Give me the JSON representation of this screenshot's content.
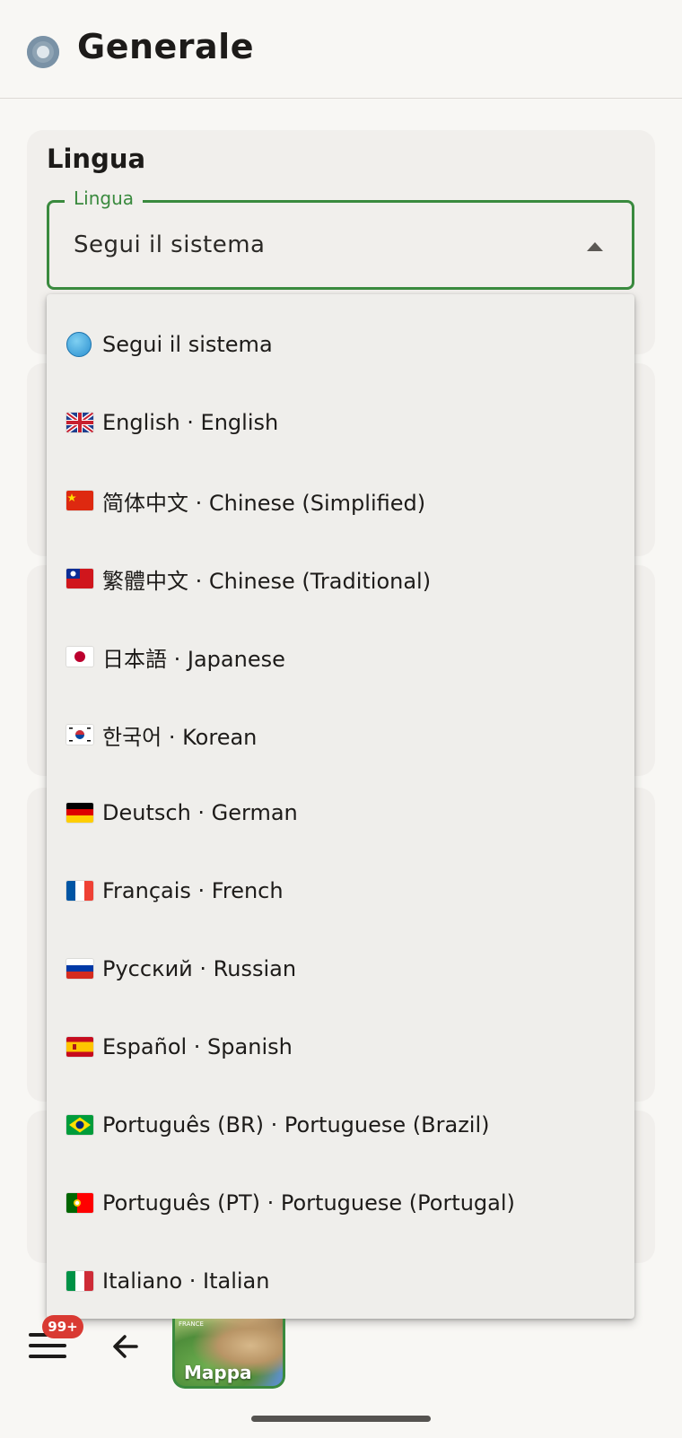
{
  "header": {
    "title": "Generale",
    "icon": "gear-icon"
  },
  "language_card": {
    "title": "Lingua",
    "field_label": "Lingua",
    "selected_value": "Segui il sistema"
  },
  "language_options": [
    {
      "label": "Segui il sistema",
      "icon": "globe-icon"
    },
    {
      "label": "English · English",
      "icon": "uk-flag-icon"
    },
    {
      "label": "简体中文 · Chinese (Simplified)",
      "icon": "china-flag-icon"
    },
    {
      "label": "繁體中文 · Chinese (Traditional)",
      "icon": "taiwan-flag-icon"
    },
    {
      "label": "日本語 · Japanese",
      "icon": "japan-flag-icon"
    },
    {
      "label": "한국어 · Korean",
      "icon": "korea-flag-icon"
    },
    {
      "label": "Deutsch · German",
      "icon": "germany-flag-icon"
    },
    {
      "label": "Français · French",
      "icon": "france-flag-icon"
    },
    {
      "label": "Русский · Russian",
      "icon": "russia-flag-icon"
    },
    {
      "label": "Español · Spanish",
      "icon": "spain-flag-icon"
    },
    {
      "label": "Português (BR) · Portuguese (Brazil)",
      "icon": "brazil-flag-icon"
    },
    {
      "label": "Português (PT) · Portuguese (Portugal)",
      "icon": "portugal-flag-icon"
    },
    {
      "label": "Italiano · Italian",
      "icon": "italy-flag-icon"
    }
  ],
  "bottom_bar": {
    "badge": "99+",
    "map_label": "Mappa",
    "map_small_text": "FRANCE"
  },
  "colors": {
    "accent": "#3a8a3e",
    "badge": "#d93a33",
    "background": "#f8f7f4",
    "dropdown": "#efeeeb"
  }
}
